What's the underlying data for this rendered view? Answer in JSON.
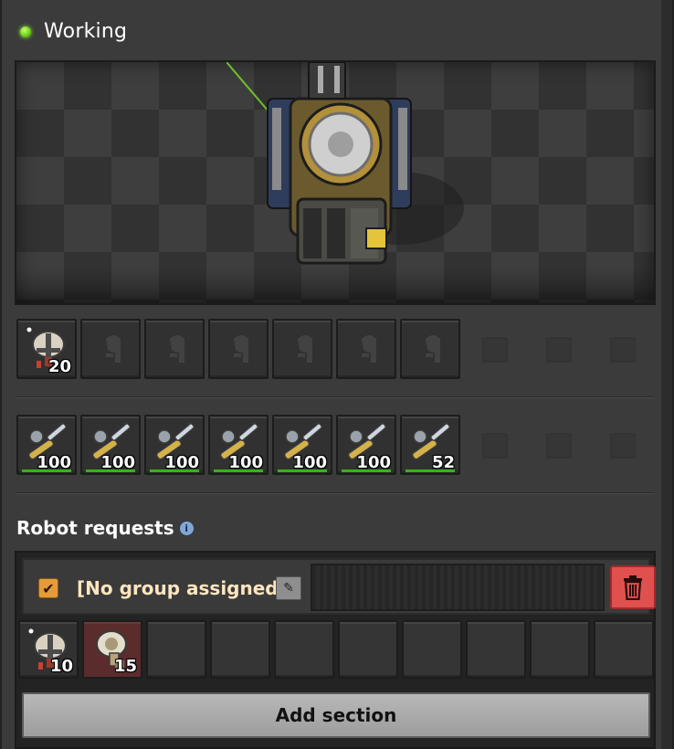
{
  "status": {
    "text": "Working",
    "color": "#6fd21c"
  },
  "robot_inventory": {
    "slots": [
      {
        "item": "construction-robot-icon",
        "count": "20"
      },
      {
        "item": "robot-placeholder-icon",
        "count": ""
      },
      {
        "item": "robot-placeholder-icon",
        "count": ""
      },
      {
        "item": "robot-placeholder-icon",
        "count": ""
      },
      {
        "item": "robot-placeholder-icon",
        "count": ""
      },
      {
        "item": "robot-placeholder-icon",
        "count": ""
      },
      {
        "item": "robot-placeholder-icon",
        "count": ""
      }
    ]
  },
  "repair_inventory": {
    "slots": [
      {
        "item": "repair-pack-icon",
        "count": "100"
      },
      {
        "item": "repair-pack-icon",
        "count": "100"
      },
      {
        "item": "repair-pack-icon",
        "count": "100"
      },
      {
        "item": "repair-pack-icon",
        "count": "100"
      },
      {
        "item": "repair-pack-icon",
        "count": "100"
      },
      {
        "item": "repair-pack-icon",
        "count": "100"
      },
      {
        "item": "repair-pack-icon",
        "count": "52"
      }
    ]
  },
  "robot_requests": {
    "title": "Robot requests",
    "group_label": "[No group assigned]",
    "requests": [
      {
        "item": "construction-robot-icon",
        "count": "10"
      },
      {
        "item": "logistic-robot-icon",
        "count": "15"
      }
    ],
    "add_section_label": "Add section"
  }
}
